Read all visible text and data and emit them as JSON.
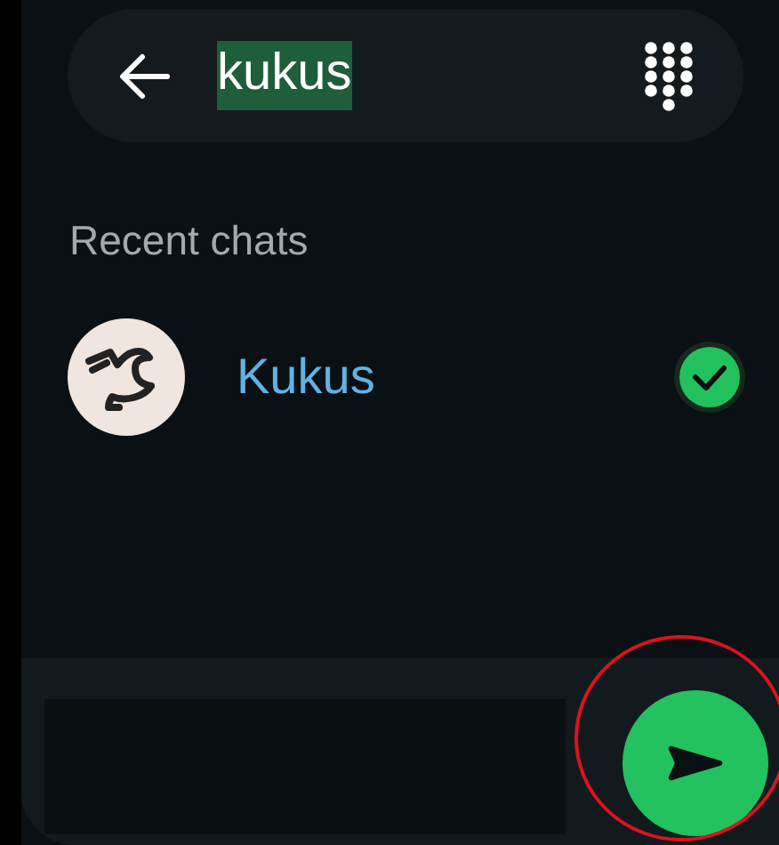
{
  "search": {
    "value": "kukus",
    "text_selected": true
  },
  "section_title": "Recent chats",
  "chats": [
    {
      "name": "Kukus",
      "selected": true
    }
  ],
  "composer": {
    "send_highlighted": true
  }
}
